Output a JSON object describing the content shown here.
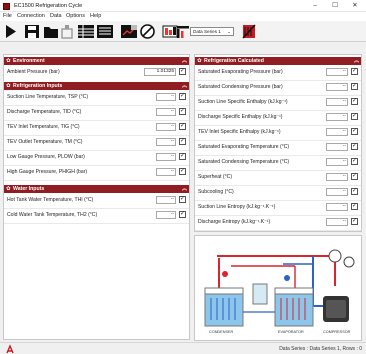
{
  "window": {
    "title": "EC1500 Refrigeration Cycle",
    "min": "–",
    "max": "☐",
    "close": "✕"
  },
  "menu": [
    "File",
    "Connection",
    "Data",
    "Options",
    "Help"
  ],
  "toolbar": {
    "series_select": "Data Series 1",
    "caret": "⌄",
    "icons": [
      "play-icon",
      "save-icon",
      "open-folder-icon",
      "export-icon",
      "table-view-icon",
      "list-view-icon",
      "chart-view-icon",
      "gauge-icon",
      "clear-icon",
      "diagram-icon",
      "settings-icon",
      "series-icon",
      "delete-series-icon"
    ]
  },
  "left": {
    "environment": {
      "title": "Environment",
      "rows": [
        {
          "label": "Ambient Pressure (bar)",
          "value": "1.01325",
          "checked": true
        }
      ]
    },
    "refrigeration_inputs": {
      "title": "Refrigeration Inputs",
      "rows": [
        {
          "label": "Suction Line Temperature, TSP (°C)",
          "value": "--",
          "checked": true
        },
        {
          "label": "Discharge Temperature, TID (°C)",
          "value": "--",
          "checked": true
        },
        {
          "label": "TEV Inlet Temperature, TIG (°C)",
          "value": "--",
          "checked": true
        },
        {
          "label": "TEV Outlet Temperature, TM (°C)",
          "value": "--",
          "checked": true
        },
        {
          "label": "Low Gauge Pressure, PLOW (bar)",
          "value": "--",
          "checked": true
        },
        {
          "label": "High Gauge Pressure, PHIGH (bar)",
          "value": "--",
          "checked": true
        }
      ]
    },
    "water_inputs": {
      "title": "Water Inputs",
      "rows": [
        {
          "label": "Hot Tank Water Temperature, THI (°C)",
          "value": "--",
          "checked": true
        },
        {
          "label": "Cold Water Tank Temperature, TH2 (°C)",
          "value": "--",
          "checked": true
        }
      ]
    }
  },
  "right": {
    "refrigeration_calculated": {
      "title": "Refrigeration Calculated",
      "rows": [
        {
          "label": "Saturated Evaporating Pressure (bar)",
          "value": "--",
          "checked": true
        },
        {
          "label": "Saturated Condensing Pressure (bar)",
          "value": "--",
          "checked": true
        },
        {
          "label": "Suction Line Specific Enthalpy (kJ.kg⁻¹)",
          "value": "--",
          "checked": true
        },
        {
          "label": "Discharge Specific Enthalpy (kJ.kg⁻¹)",
          "value": "--",
          "checked": true
        },
        {
          "label": "TEV Inlet Specific Enthalpy (kJ.kg⁻¹)",
          "value": "--",
          "checked": true
        },
        {
          "label": "Saturated Evaporating Temperature (°C)",
          "value": "--",
          "checked": true
        },
        {
          "label": "Saturated Condensing Temperature (°C)",
          "value": "--",
          "checked": true
        },
        {
          "label": "Superheat (°C)",
          "value": "--",
          "checked": true
        },
        {
          "label": "Subcooling (°C)",
          "value": "--",
          "checked": true
        },
        {
          "label": "Suction Line Entropy (kJ.kg⁻¹.K⁻¹)",
          "value": "--",
          "checked": true
        },
        {
          "label": "Discharge Entropy (kJ.kg⁻¹.K⁻¹)",
          "value": "--",
          "checked": true
        }
      ]
    }
  },
  "diagram": {
    "labels": {
      "condenser": "CONDENSER",
      "evaporator": "EVAPORATOR",
      "compressor": "COMPRESSOR"
    }
  },
  "status": {
    "text": "Data Series : Data Series 1,  Rows : 0"
  },
  "common": {
    "gear": "✿",
    "chevron": "︽",
    "check": "✓"
  },
  "colors": {
    "section_header": "#8f1d21",
    "pipe_red": "#d9252b",
    "pipe_blue": "#2a63c9",
    "tank_blue": "#8cc6ea"
  }
}
